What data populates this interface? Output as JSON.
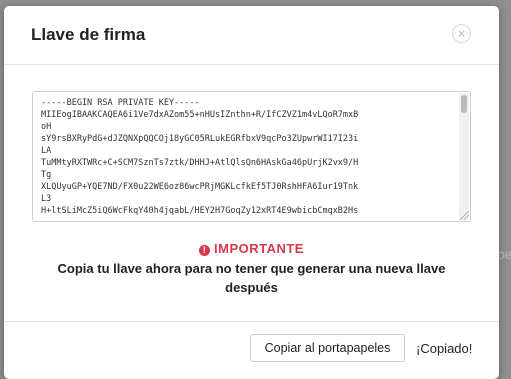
{
  "modal": {
    "title": "Llave de firma",
    "close_glyph": "×",
    "key_text": "-----BEGIN RSA PRIVATE KEY-----\nMIIEogIBAAKCAQEA6i1Ve7dxAZom55+nHUsIZnthn+R/IfCZVZ1m4vLQoR7mxB\noH\nsY9rsBXRyPdG+dJZQNXpQQCOj18yGC05RLukEGRfbxV9qcPo3ZUpwrWI17I23i\nLA\nTuMMtyRXTWRc+C+SCM7SznTs7ztk/DHHJ+AtlQlsQn6HAskGa46pUrjK2vx9/H\nTg\nXLQUyuGP+YQE7ND/FX0u22WE6oz86wcPRjMGKLcfkEf5TJ0RshHFA6Iur19Tnk\nL3\nH+ltSLiMcZ5iQ6WcFkqY40h4jqabL/HEY2H7GoqZy12xRT4E9wbicbCmqxB2Hs",
    "warning_icon": "!",
    "important_label": "IMPORTANTE",
    "message": "Copia tu llave ahora para no tener que generar una nueva llave después",
    "copy_button": "Copiar al portapapeles",
    "copied_status": "¡Copiado!"
  },
  "backdrop": {
    "partial_text": "pe"
  }
}
